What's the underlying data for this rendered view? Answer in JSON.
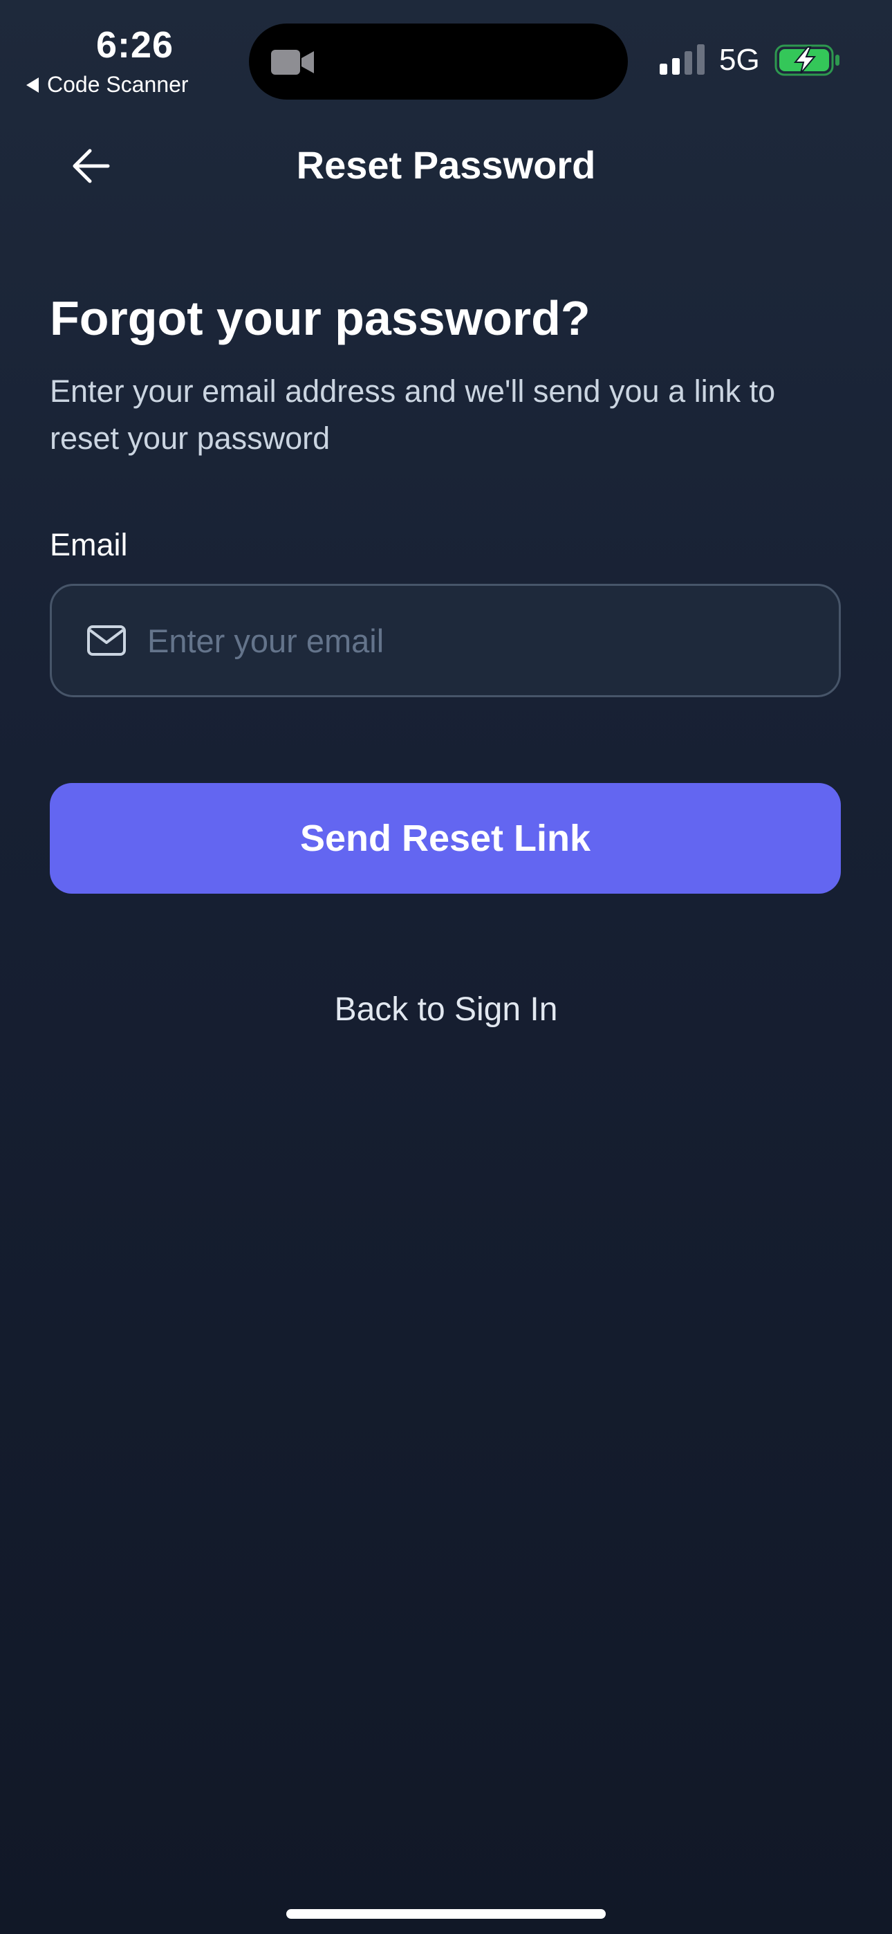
{
  "status_bar": {
    "time": "6:26",
    "back_app": "Code Scanner",
    "network": "5G",
    "battery_color": "#34c759",
    "signal_bars_active": 2,
    "signal_bars_total": 4,
    "icons": [
      "video-camera-icon",
      "signal-icon",
      "battery-charging-icon"
    ]
  },
  "nav": {
    "title": "Reset Password",
    "back_icon": "arrow-left-icon"
  },
  "content": {
    "heading": "Forgot your password?",
    "subtext": "Enter your email address and we'll send you a link to reset your password",
    "email_label": "Email",
    "email_placeholder": "Enter your email",
    "email_value": "",
    "email_icon": "mail-icon",
    "submit_label": "Send Reset Link",
    "back_link": "Back to Sign In"
  },
  "colors": {
    "primary": "#6366f1",
    "background_top": "#1e293b",
    "background_bottom": "#111827",
    "input_border": "#475569",
    "muted_text": "#cbd5e1",
    "placeholder": "#64748b"
  }
}
